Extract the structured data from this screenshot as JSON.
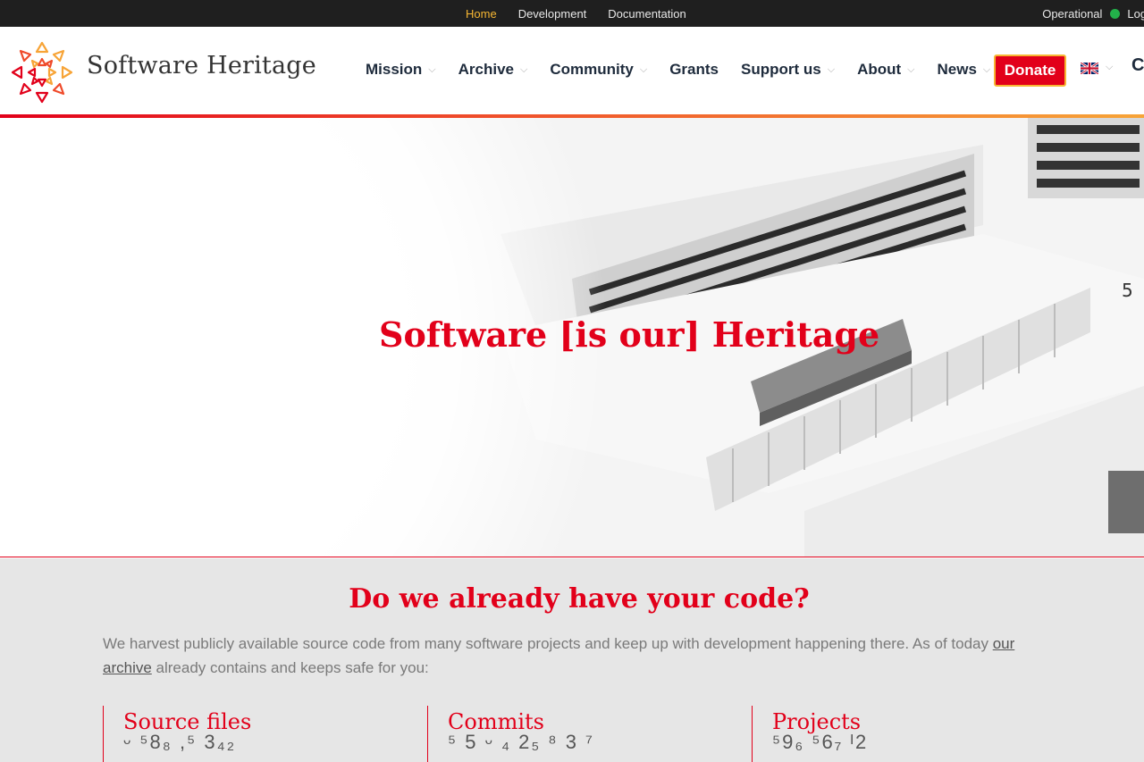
{
  "topbar": {
    "links": [
      "Home",
      "Development",
      "Documentation"
    ],
    "status_label": "Operational",
    "login_label": "Logi"
  },
  "header": {
    "brand": "Software Heritage",
    "nav": [
      "Mission",
      "Archive",
      "Community",
      "Grants",
      "Support us",
      "About",
      "News"
    ],
    "donate_label": "Donate",
    "search_glyph": "C"
  },
  "hero": {
    "title": "Software [is our] Heritage"
  },
  "section": {
    "title": "Do we already have your code?",
    "text_before": "We harvest publicly available source code from many software projects and keep up with development happening there. As of today ",
    "link_text": "our archive",
    "text_after": " already contains and keeps safe for you:",
    "stats": [
      {
        "label": "Source files",
        "digits": "ᵕ ⁵8₈  ,⁵ 3₄₂"
      },
      {
        "label": "Commits",
        "digits": "⁵ 5 ᵕ ₄ 2₅ ⁸ 3  ⁷"
      },
      {
        "label": "Projects",
        "digits": "⁵9₆ ⁵6₇ ᴵ2"
      }
    ]
  },
  "colors": {
    "brand_red": "#e2001a",
    "accent_yellow": "#f7b733",
    "topbar_bg": "#1f1f1f",
    "status_green": "#23b04a"
  }
}
